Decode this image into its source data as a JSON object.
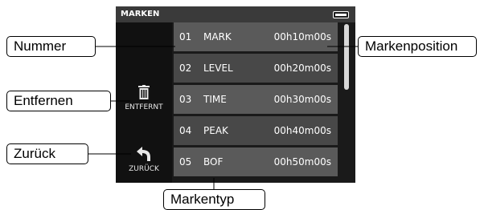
{
  "screen": {
    "title": "MARKEN"
  },
  "side_buttons": {
    "delete_label": "ENTFERNT",
    "back_label": "ZURÜCK"
  },
  "marks": [
    {
      "num": "01",
      "type": "MARK",
      "pos": "00h10m00s"
    },
    {
      "num": "02",
      "type": "LEVEL",
      "pos": "00h20m00s"
    },
    {
      "num": "03",
      "type": "TIME",
      "pos": "00h30m00s"
    },
    {
      "num": "04",
      "type": "PEAK",
      "pos": "00h40m00s"
    },
    {
      "num": "05",
      "type": "BOF",
      "pos": "00h50m00s"
    }
  ],
  "scrollbar": {
    "position_fraction": 0.0,
    "visible_fraction": 0.42
  },
  "callouts": {
    "nummer": "Nummer",
    "entfernen": "Entfernen",
    "zurueck": "Zurück",
    "markenposition": "Markenposition",
    "markentyp": "Markentyp"
  },
  "icons": {
    "battery": "battery-icon",
    "delete": "trash-icon",
    "back": "back-arrow-icon"
  }
}
